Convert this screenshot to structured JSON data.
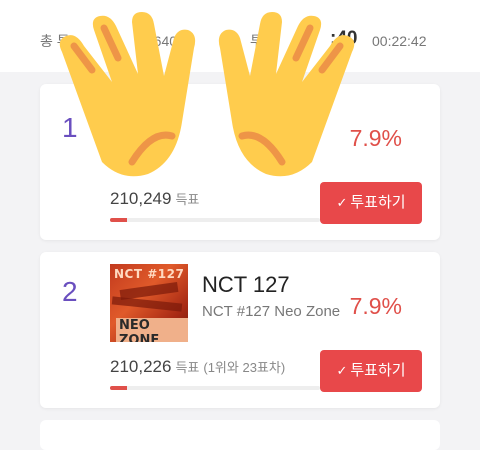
{
  "header": {
    "total_label": "총 투",
    "total_count": "1,640",
    "vote_label": "투",
    "time_big": ":40",
    "time_small": "00:22:42"
  },
  "entries": [
    {
      "rank": "1",
      "percent": "7.9%",
      "votes": "210,249",
      "votes_unit": "득표",
      "vote_fraction": 0.08,
      "button_label": "투표하기"
    },
    {
      "rank": "2",
      "artist": "NCT 127",
      "album": "NCT #127 Neo Zone",
      "thumb_title": "NCT #127",
      "thumb_subtitle": "NEO ZONE",
      "percent": "7.9%",
      "votes": "210,226",
      "votes_unit": "득표",
      "votes_note": "(1위와 23표차)",
      "vote_fraction": 0.08,
      "button_label": "투표하기"
    }
  ],
  "overlay": {
    "icon": "raising-hands-emoji"
  },
  "colors": {
    "accent": "#e8484a",
    "rank": "#6a4fbf",
    "percent": "#e0504a"
  }
}
